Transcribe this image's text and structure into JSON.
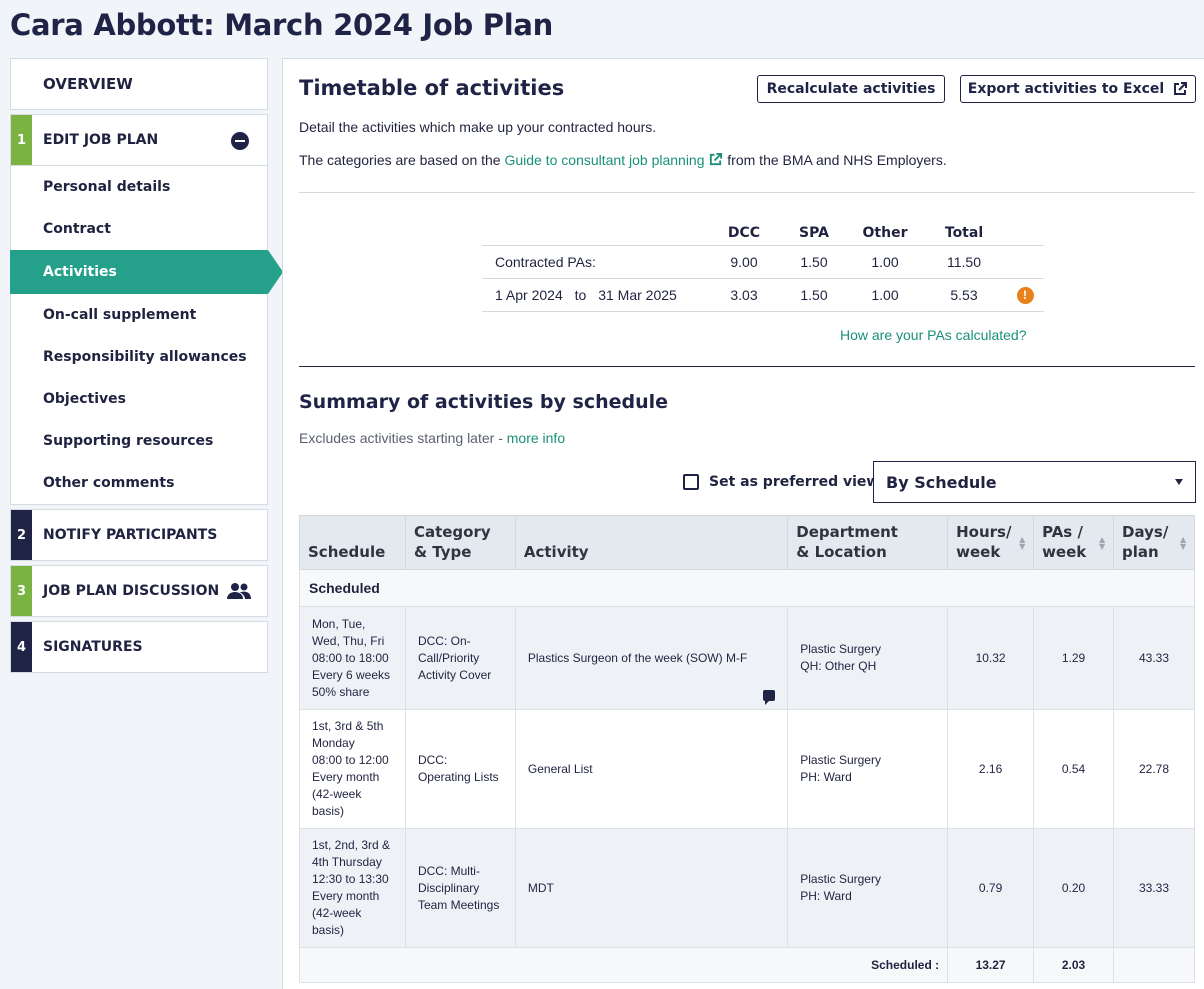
{
  "page": {
    "title": "Cara Abbott: March 2024 Job Plan"
  },
  "sidebar": {
    "overview": "OVERVIEW",
    "steps": [
      {
        "num": "1",
        "label": "EDIT JOB PLAN"
      },
      {
        "num": "2",
        "label": "NOTIFY PARTICIPANTS"
      },
      {
        "num": "3",
        "label": "JOB PLAN DISCUSSION"
      },
      {
        "num": "4",
        "label": "SIGNATURES"
      }
    ],
    "items": [
      {
        "label": "Personal details"
      },
      {
        "label": "Contract"
      },
      {
        "label": "Activities"
      },
      {
        "label": "On-call supplement"
      },
      {
        "label": "Responsibility allowances"
      },
      {
        "label": "Objectives"
      },
      {
        "label": "Supporting resources"
      },
      {
        "label": "Other comments"
      }
    ]
  },
  "main": {
    "heading": "Timetable of activities",
    "recalc_label": "Recalculate activities",
    "export_label": "Export activities to Excel",
    "intro": "Detail the activities which make up your contracted hours.",
    "guide_prefix": "The categories are based on the",
    "guide_link": "Guide to consultant job planning",
    "guide_suffix": "from the BMA and NHS Employers.",
    "pa_table": {
      "headers": [
        "DCC",
        "SPA",
        "Other",
        "Total"
      ],
      "contracted_label": "Contracted PAs:",
      "contracted": [
        "9.00",
        "1.50",
        "1.00",
        "11.50"
      ],
      "period_from": "1 Apr 2024",
      "period_to_word": "to",
      "period_to": "31 Mar 2025",
      "period": [
        "3.03",
        "1.50",
        "1.00",
        "5.53"
      ]
    },
    "pa_link": "How are your PAs calculated?",
    "summary_heading": "Summary of activities by schedule",
    "excludes_text": "Excludes activities starting later -",
    "more_info": "more info",
    "preferred_label": "Set as preferred view",
    "view_select": "By Schedule",
    "table": {
      "headers": {
        "schedule": "Schedule",
        "category_1": "Category",
        "category_2": "& Type",
        "activity": "Activity",
        "dept_1": "Department",
        "dept_2": "& Location",
        "hours_1": "Hours/",
        "hours_2": "week",
        "pas_1": "PAs /",
        "pas_2": "week",
        "days_1": "Days/",
        "days_2": "plan"
      },
      "group": "Scheduled",
      "rows": [
        {
          "schedule": [
            "Mon, Tue,",
            "Wed, Thu, Fri",
            "08:00 to 18:00",
            "Every 6 weeks",
            "50% share"
          ],
          "category": [
            "DCC: On-",
            "Call/Priority",
            "Activity Cover"
          ],
          "activity": "Plastics Surgeon of the week (SOW) M-F",
          "dept": [
            "Plastic Surgery",
            "QH: Other QH"
          ],
          "hours": "10.32",
          "pas": "1.29",
          "days": "43.33"
        },
        {
          "schedule": [
            "1st, 3rd & 5th",
            "Monday",
            "08:00 to 12:00",
            "Every month",
            "(42-week",
            "basis)"
          ],
          "category": [
            "DCC:",
            "Operating Lists"
          ],
          "activity": "General List",
          "dept": [
            "Plastic Surgery",
            "PH: Ward"
          ],
          "hours": "2.16",
          "pas": "0.54",
          "days": "22.78"
        },
        {
          "schedule": [
            "1st, 2nd, 3rd &",
            "4th Thursday",
            "12:30 to 13:30",
            "Every month",
            "(42-week",
            "basis)"
          ],
          "category": [
            "DCC: Multi-",
            "Disciplinary",
            "Team Meetings"
          ],
          "activity": "MDT",
          "dept": [
            "Plastic Surgery",
            "PH: Ward"
          ],
          "hours": "0.79",
          "pas": "0.20",
          "days": "33.33"
        }
      ],
      "total_label": "Scheduled :",
      "total_hours": "13.27",
      "total_pas": "2.03"
    }
  }
}
